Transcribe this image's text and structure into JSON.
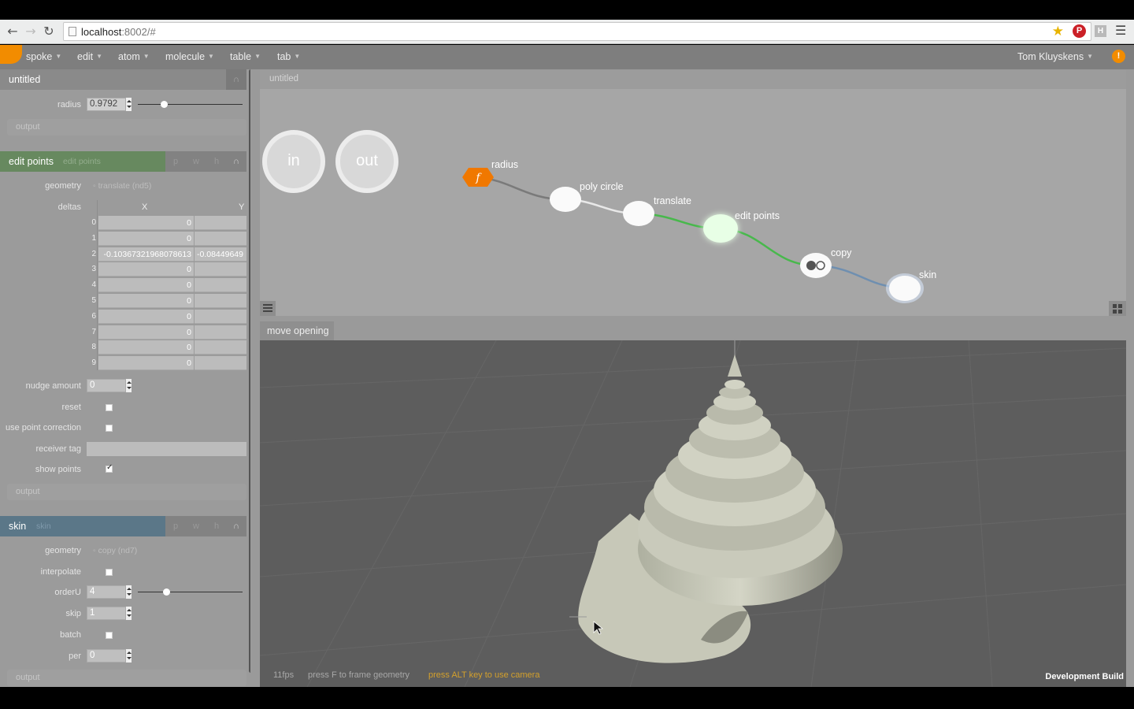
{
  "browser": {
    "url_host": "localhost",
    "url_rest": ":8002/#"
  },
  "menu": {
    "items": [
      "spoke",
      "edit",
      "atom",
      "molecule",
      "table",
      "tab"
    ],
    "user": "Tom Kluyskens",
    "alert": "!"
  },
  "left_panel": {
    "doc_title": "untitled",
    "radius_label": "radius",
    "radius_value": "0.9792",
    "radius_slider": 0.25,
    "output_label": "output",
    "edit_points": {
      "title": "edit points",
      "subtitle": "edit points",
      "buttons": [
        "p",
        "w",
        "h",
        "∩"
      ],
      "geometry_label": "geometry",
      "geometry_value": "translate (nd5)",
      "deltas_label": "deltas",
      "col_x": "X",
      "col_y": "Y",
      "rows": [
        {
          "i": "0",
          "x": "0",
          "y": ""
        },
        {
          "i": "1",
          "x": "0",
          "y": ""
        },
        {
          "i": "2",
          "x": "-0.10367321968078613",
          "y": "-0.08449649"
        },
        {
          "i": "3",
          "x": "0",
          "y": ""
        },
        {
          "i": "4",
          "x": "0",
          "y": ""
        },
        {
          "i": "5",
          "x": "0",
          "y": ""
        },
        {
          "i": "6",
          "x": "0",
          "y": ""
        },
        {
          "i": "7",
          "x": "0",
          "y": ""
        },
        {
          "i": "8",
          "x": "0",
          "y": ""
        },
        {
          "i": "9",
          "x": "0",
          "y": ""
        }
      ],
      "nudge_label": "nudge amount",
      "nudge_value": "0",
      "reset_label": "reset",
      "upc_label": "use point correction",
      "receiver_label": "receiver tag",
      "show_points_label": "show points",
      "output_label": "output"
    },
    "skin": {
      "title": "skin",
      "subtitle": "skin",
      "buttons": [
        "p",
        "w",
        "h",
        "∩"
      ],
      "geometry_label": "geometry",
      "geometry_value": "copy (nd7)",
      "interpolate_label": "interpolate",
      "orderU_label": "orderU",
      "orderU_value": "4",
      "orderU_slider": 0.27,
      "skip_label": "skip",
      "skip_value": "1",
      "batch_label": "batch",
      "per_label": "per",
      "per_value": "0",
      "output_label": "output"
    }
  },
  "graph": {
    "tab": "untitled",
    "in_label": "in",
    "out_label": "out",
    "nodes": [
      {
        "name": "radius",
        "kind": "float",
        "glyph": "f"
      },
      {
        "name": "poly circle",
        "kind": "node"
      },
      {
        "name": "translate",
        "kind": "node"
      },
      {
        "name": "edit points",
        "kind": "node-active"
      },
      {
        "name": "copy",
        "kind": "copy"
      },
      {
        "name": "skin",
        "kind": "node-selected"
      }
    ]
  },
  "viewport": {
    "tab": "move opening",
    "fps": "11fps",
    "hint": "press F to frame geometry",
    "camera_hint": "press ALT key to use camera",
    "build": "Development Build"
  },
  "colors": {
    "accent_orange": "#f28c00",
    "edit_points_header": "#6a8f64",
    "skin_header": "#5f7b8f",
    "active_wire": "#4bbf4f",
    "selected_wire": "#6f8fb0"
  }
}
